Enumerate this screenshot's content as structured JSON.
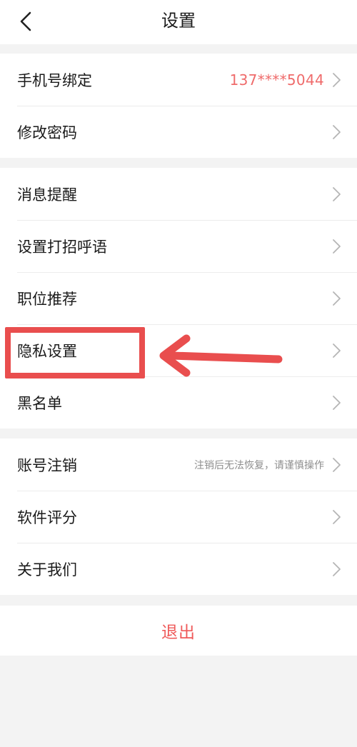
{
  "header": {
    "title": "设置",
    "back_icon": "chevron-left-icon"
  },
  "groups": [
    {
      "items": [
        {
          "label": "手机号绑定",
          "value": "137****5044"
        },
        {
          "label": "修改密码"
        }
      ]
    },
    {
      "items": [
        {
          "label": "消息提醒"
        },
        {
          "label": "设置打招呼语"
        },
        {
          "label": "职位推荐"
        },
        {
          "label": "隐私设置"
        },
        {
          "label": "黑名单"
        }
      ]
    },
    {
      "items": [
        {
          "label": "账号注销",
          "hint": "注销后无法恢复，请谨慎操作"
        },
        {
          "label": "软件评分"
        },
        {
          "label": "关于我们"
        }
      ]
    }
  ],
  "logout": {
    "label": "退出"
  },
  "colors": {
    "accent": "#ef6b6b",
    "annotation": "#e94e4e",
    "background": "#f3f3f3"
  },
  "annotation": {
    "highlighted_item": "隐私设置",
    "arrow_icon": "arrow-left-icon"
  }
}
